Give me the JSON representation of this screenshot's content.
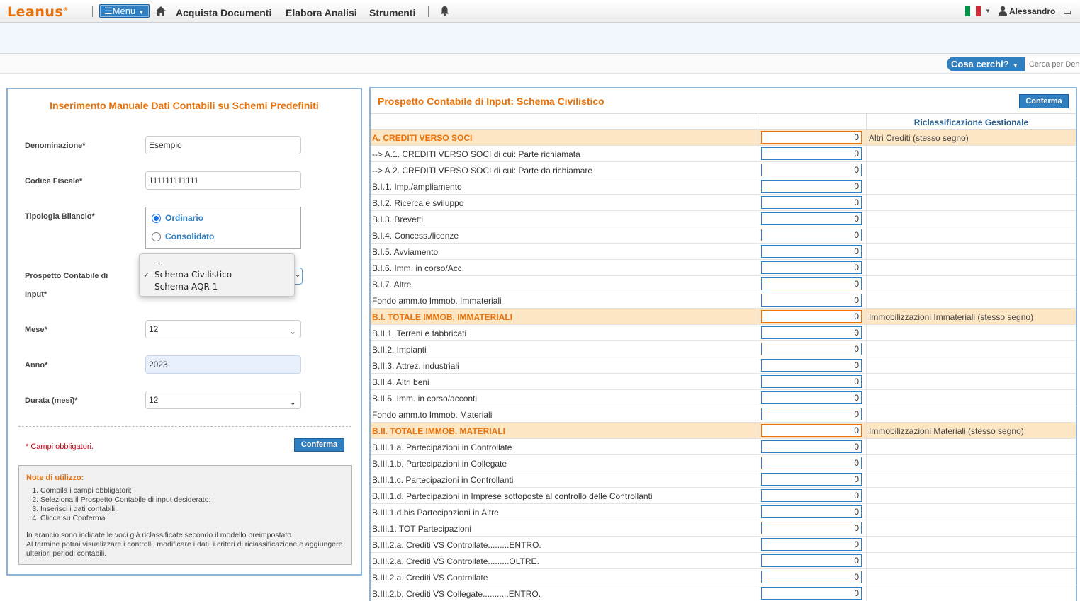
{
  "nav": {
    "logo": "Leanus",
    "menu_label": "Menu",
    "links": [
      "Acquista Documenti",
      "Elabora Analisi",
      "Strumenti"
    ],
    "user": "Alessandro"
  },
  "search": {
    "button_label": "Cosa cerchi?",
    "placeholder": "Cerca per Denominazione"
  },
  "form": {
    "title": "Inserimento Manuale Dati Contabili su Schemi Predefiniti",
    "denominazione_label": "Denominazione*",
    "denominazione_value": "Esempio",
    "codice_label": "Codice Fiscale*",
    "codice_value": "111111111111",
    "tipologia_label": "Tipologia Bilancio*",
    "tipologia_options": [
      "Ordinario",
      "Consolidato"
    ],
    "tipologia_selected": "Ordinario",
    "prospetto_label_1": "Prospetto Contabile di",
    "prospetto_label_2": "Input*",
    "prospetto_options": [
      "---",
      "Schema Civilistico",
      "Schema AQR 1"
    ],
    "prospetto_selected": "Schema Civilistico",
    "mese_label": "Mese*",
    "mese_value": "12",
    "anno_label": "Anno*",
    "anno_value": "2023",
    "durata_label": "Durata (mesi)*",
    "durata_value": "12",
    "required_note": "* Campi obbligatori.",
    "confirm_label": "Conferma"
  },
  "notes": {
    "title": "Note di utilizzo:",
    "steps": [
      "Compila i campi obbligatori;",
      "Seleziona il Prospetto Contabile di input desiderato;",
      "Inserisci i dati contabili.",
      "Clicca su Conferma"
    ],
    "text_1": "In arancio sono indicate le voci già riclassificate secondo il modello preimpostato",
    "text_2": "Al termine potrai visualizzare i controlli, modificare i dati, i criteri di riclassificazione e aggiungere ulteriori periodi contabili."
  },
  "prospetto": {
    "title": "Prospetto Contabile di Input: Schema Civilistico",
    "confirm_label": "Conferma",
    "column_header": "Riclassificazione Gestionale",
    "rows": [
      {
        "label": "A. CREDITI VERSO SOCI",
        "value": "0",
        "total": true,
        "mapping": "Altri Crediti (stesso segno)"
      },
      {
        "label": "--> A.1. CREDITI VERSO SOCI di cui: Parte richiamata",
        "value": "0",
        "total": false,
        "mapping": ""
      },
      {
        "label": "--> A.2. CREDITI VERSO SOCI di cui: Parte da richiamare",
        "value": "0",
        "total": false,
        "mapping": ""
      },
      {
        "label": "B.I.1. Imp./ampliamento",
        "value": "0",
        "total": false,
        "mapping": ""
      },
      {
        "label": "B.I.2. Ricerca e sviluppo",
        "value": "0",
        "total": false,
        "mapping": ""
      },
      {
        "label": "B.I.3. Brevetti",
        "value": "0",
        "total": false,
        "mapping": ""
      },
      {
        "label": "B.I.4. Concess./licenze",
        "value": "0",
        "total": false,
        "mapping": ""
      },
      {
        "label": "B.I.5. Avviamento",
        "value": "0",
        "total": false,
        "mapping": ""
      },
      {
        "label": "B.I.6. Imm. in corso/Acc.",
        "value": "0",
        "total": false,
        "mapping": ""
      },
      {
        "label": "B.I.7. Altre",
        "value": "0",
        "total": false,
        "mapping": ""
      },
      {
        "label": "Fondo amm.to Immob. Immateriali",
        "value": "0",
        "total": false,
        "mapping": ""
      },
      {
        "label": "B.I. TOTALE IMMOB. IMMATERIALI",
        "value": "0",
        "total": true,
        "mapping": "Immobilizzazioni Immateriali (stesso segno)"
      },
      {
        "label": "B.II.1. Terreni e fabbricati",
        "value": "0",
        "total": false,
        "mapping": ""
      },
      {
        "label": "B.II.2. Impianti",
        "value": "0",
        "total": false,
        "mapping": ""
      },
      {
        "label": "B.II.3. Attrez. industriali",
        "value": "0",
        "total": false,
        "mapping": ""
      },
      {
        "label": "B.II.4. Altri beni",
        "value": "0",
        "total": false,
        "mapping": ""
      },
      {
        "label": "B.II.5. Imm. in corso/acconti",
        "value": "0",
        "total": false,
        "mapping": ""
      },
      {
        "label": "Fondo amm.to Immob. Materiali",
        "value": "0",
        "total": false,
        "mapping": ""
      },
      {
        "label": "B.II. TOTALE IMMOB. MATERIALI",
        "value": "0",
        "total": true,
        "mapping": "Immobilizzazioni Materiali (stesso segno)"
      },
      {
        "label": "B.III.1.a. Partecipazioni in Controllate",
        "value": "0",
        "total": false,
        "mapping": ""
      },
      {
        "label": "B.III.1.b. Partecipazioni in Collegate",
        "value": "0",
        "total": false,
        "mapping": ""
      },
      {
        "label": "B.III.1.c. Partecipazioni in Controllanti",
        "value": "0",
        "total": false,
        "mapping": ""
      },
      {
        "label": "B.III.1.d. Partecipazioni in Imprese sottoposte al controllo delle Controllanti",
        "value": "0",
        "total": false,
        "mapping": ""
      },
      {
        "label": "B.III.1.d.bis Partecipazioni in Altre",
        "value": "0",
        "total": false,
        "mapping": ""
      },
      {
        "label": "B.III.1. TOT Partecipazioni",
        "value": "0",
        "total": false,
        "mapping": ""
      },
      {
        "label": "B.III.2.a. Crediti VS Controllate.........ENTRO.",
        "value": "0",
        "total": false,
        "mapping": ""
      },
      {
        "label": "B.III.2.a. Crediti VS Controllate.........OLTRE.",
        "value": "0",
        "total": false,
        "mapping": ""
      },
      {
        "label": "B.III.2.a. Crediti VS Controllate",
        "value": "0",
        "total": false,
        "mapping": ""
      },
      {
        "label": "B.III.2.b. Crediti VS Collegate...........ENTRO.",
        "value": "0",
        "total": false,
        "mapping": ""
      }
    ]
  },
  "colors": {
    "accent_orange": "#e8730c",
    "accent_blue": "#2f7fc1",
    "total_row_bg": "#fde6c4"
  }
}
